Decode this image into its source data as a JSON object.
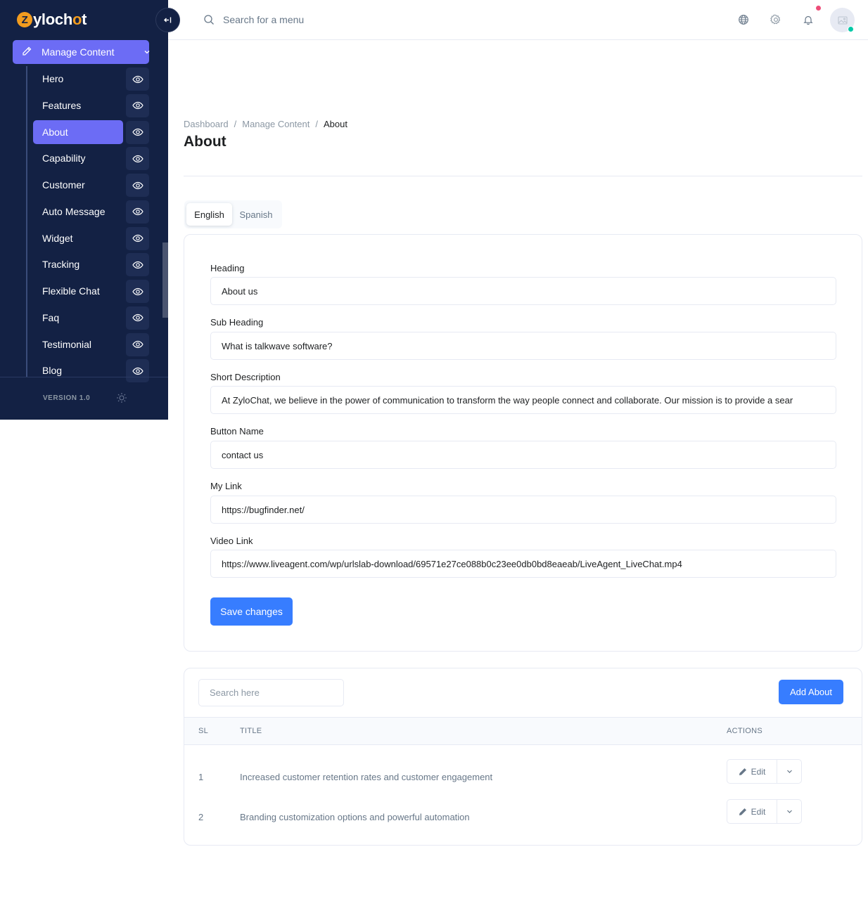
{
  "brand": {
    "z": "Z",
    "before": "yloch",
    "o": "o",
    "after": "t"
  },
  "sidebar": {
    "manage_content_label": "Manage Content",
    "items": [
      {
        "label": "Hero",
        "active": false
      },
      {
        "label": "Features",
        "active": false
      },
      {
        "label": "About",
        "active": true
      },
      {
        "label": "Capability",
        "active": false
      },
      {
        "label": "Customer",
        "active": false
      },
      {
        "label": "Auto Message",
        "active": false
      },
      {
        "label": "Widget",
        "active": false
      },
      {
        "label": "Tracking",
        "active": false
      },
      {
        "label": "Flexible Chat",
        "active": false
      },
      {
        "label": "Faq",
        "active": false
      },
      {
        "label": "Testimonial",
        "active": false
      },
      {
        "label": "Blog",
        "active": false
      }
    ],
    "version": "VERSION 1.0"
  },
  "header": {
    "search_placeholder": "Search for a menu"
  },
  "breadcrumb": {
    "items": [
      "Dashboard",
      "Manage Content",
      "About"
    ]
  },
  "page_title": "About",
  "tabs": {
    "english": "English",
    "spanish": "Spanish"
  },
  "form": {
    "heading_label": "Heading",
    "heading_value": "About us",
    "sub_heading_label": "Sub Heading",
    "sub_heading_value": "What is talkwave software?",
    "short_description_label": "Short Description",
    "short_description_value": "At ZyloChat, we believe in the power of communication to transform the way people connect and collaborate. Our mission is to provide a sear",
    "button_name_label": "Button Name",
    "button_name_value": "contact us",
    "my_link_label": "My Link",
    "my_link_value": "https://bugfinder.net/",
    "video_link_label": "Video Link",
    "video_link_value": "https://www.liveagent.com/wp/urlslab-download/69571e27ce088b0c23ee0db0bd8eaeab/LiveAgent_LiveChat.mp4",
    "save_label": "Save changes"
  },
  "table": {
    "search_placeholder": "Search here",
    "add_label": "Add About",
    "headers": {
      "sl": "SL",
      "title": "TITLE",
      "actions": "ACTIONS"
    },
    "rows": [
      {
        "sl": "1",
        "title": "Increased customer retention rates and customer engagement",
        "edit": "Edit"
      },
      {
        "sl": "2",
        "title": "Branding customization options and powerful automation",
        "edit": "Edit"
      }
    ]
  },
  "colors": {
    "sidebar_bg": "#132144",
    "accent_purple": "#6c6cf5",
    "primary_blue": "#377dff",
    "brand_orange": "#f29c1f",
    "notify_red": "#ed4c78",
    "online_green": "#00c9a7"
  }
}
